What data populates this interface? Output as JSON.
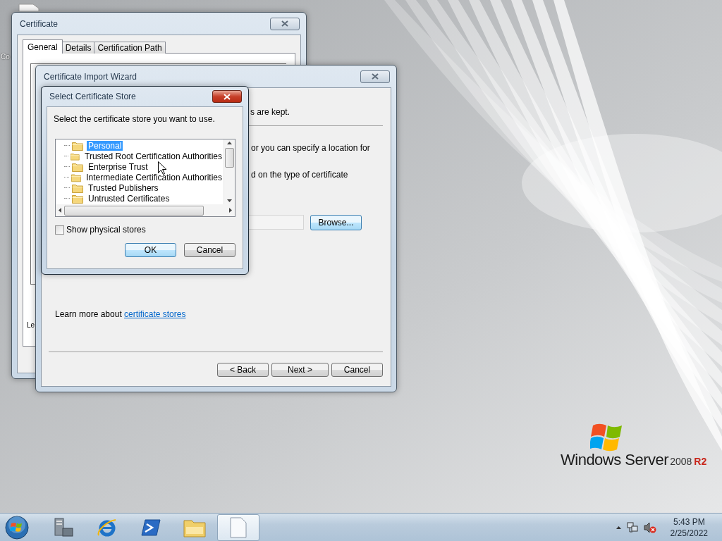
{
  "desktop": {
    "icon_label": "Co"
  },
  "certificate_window": {
    "title": "Certificate",
    "tabs": [
      {
        "label": "General",
        "selected": true
      },
      {
        "label": "Details",
        "selected": false
      },
      {
        "label": "Certification Path",
        "selected": false
      }
    ],
    "partial_text": "Le"
  },
  "import_wizard": {
    "title": "Certificate Import Wizard",
    "lines": [
      "s are kept.",
      "or you can specify a location for",
      "d on the type of certificate"
    ],
    "browse_button": "Browse...",
    "learn_more": {
      "text": "Learn more about ",
      "link": "certificate stores"
    },
    "buttons": [
      {
        "label": "< Back"
      },
      {
        "label": "Next >"
      },
      {
        "label": "Cancel"
      }
    ]
  },
  "select_store_dialog": {
    "title": "Select Certificate Store",
    "prompt": "Select the certificate store you want to use.",
    "stores": [
      {
        "label": "Personal",
        "selected": true
      },
      {
        "label": "Trusted Root Certification Authorities",
        "selected": false
      },
      {
        "label": "Enterprise Trust",
        "selected": false
      },
      {
        "label": "Intermediate Certification Authorities",
        "selected": false
      },
      {
        "label": "Trusted Publishers",
        "selected": false
      },
      {
        "label": "Untrusted Certificates",
        "selected": false
      }
    ],
    "show_physical_stores": {
      "label": "Show physical stores",
      "checked": false
    },
    "buttons": [
      {
        "label": "OK",
        "default": true
      },
      {
        "label": "Cancel",
        "default": false
      }
    ]
  },
  "taskbar": {
    "apps": [
      {
        "kind": "server",
        "active": false
      },
      {
        "kind": "browser",
        "active": false
      },
      {
        "kind": "terminal",
        "active": false
      },
      {
        "kind": "folder",
        "active": false
      },
      {
        "kind": "document",
        "active": true
      }
    ],
    "clock": {
      "time": "5:43 PM",
      "date": "2/25/2022"
    }
  },
  "logo": {
    "brand": "Windows Server",
    "version": "2008",
    "edition": "R2"
  }
}
